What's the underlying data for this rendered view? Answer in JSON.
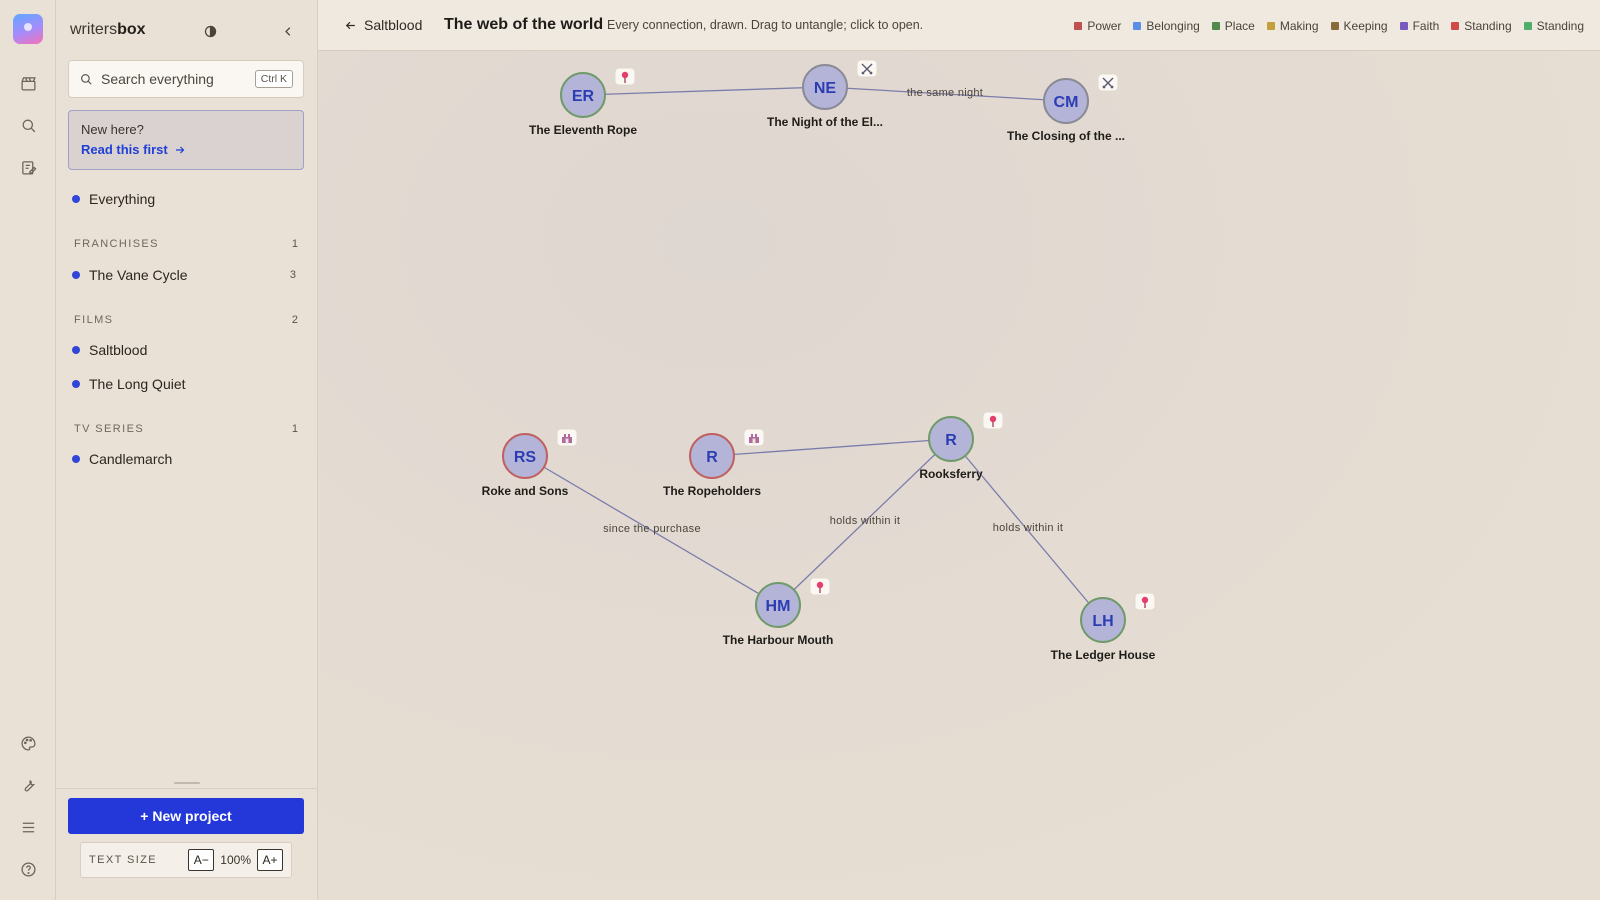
{
  "sidebar": {
    "brand_left": "writers",
    "brand_right": "box",
    "search_placeholder": "Search everything",
    "search_shortcut": "Ctrl K",
    "notice_title": "New here?",
    "notice_link": "Read this first",
    "everything": "Everything",
    "sections": [
      {
        "title": "FRANCHISES",
        "count": "1",
        "items": [
          {
            "label": "The Vane Cycle",
            "count": "3"
          }
        ]
      },
      {
        "title": "FILMS",
        "count": "2",
        "items": [
          {
            "label": "Saltblood",
            "count": ""
          },
          {
            "label": "The Long Quiet",
            "count": ""
          }
        ]
      },
      {
        "title": "TV SERIES",
        "count": "1",
        "items": [
          {
            "label": "Candlemarch",
            "count": ""
          }
        ]
      }
    ],
    "new_project": "+ New project",
    "text_size_label": "TEXT SIZE",
    "text_size_dec": "A−",
    "text_size_value": "100%",
    "text_size_inc": "A+"
  },
  "header": {
    "back_label": "Saltblood",
    "title": "The web of the world",
    "subtitle": "Every connection, drawn. Drag to untangle; click to open.",
    "legend": [
      {
        "label": "Power",
        "color": "#c0504d"
      },
      {
        "label": "Belonging",
        "color": "#5b8ee6"
      },
      {
        "label": "Place",
        "color": "#4f8a4f"
      },
      {
        "label": "Making",
        "color": "#c4a03a"
      },
      {
        "label": "Keeping",
        "color": "#8a6a3a"
      },
      {
        "label": "Faith",
        "color": "#7b5bbf"
      },
      {
        "label": "Standing",
        "color": "#d04a4a"
      },
      {
        "label": "Standing",
        "color": "#4fae6a"
      }
    ]
  },
  "graph": {
    "nodes": [
      {
        "id": "er",
        "initials": "ER",
        "label": "The Eleventh Rope",
        "ring": "#6f9a6a",
        "badge": "pin"
      },
      {
        "id": "ne",
        "initials": "NE",
        "label": "The Night of the El...",
        "ring": "#8a8a96",
        "badge": "swords"
      },
      {
        "id": "cm",
        "initials": "CM",
        "label": "The Closing of the ...",
        "ring": "#8a8a96",
        "badge": "swords"
      },
      {
        "id": "rs",
        "initials": "RS",
        "label": "Roke and Sons",
        "ring": "#c06060",
        "badge": "castle"
      },
      {
        "id": "rh",
        "initials": "R",
        "label": "The Ropeholders",
        "ring": "#c06060",
        "badge": "castle"
      },
      {
        "id": "rf",
        "initials": "R",
        "label": "Rooksferry",
        "ring": "#6f9a6a",
        "badge": "pin"
      },
      {
        "id": "hm",
        "initials": "HM",
        "label": "The Harbour Mouth",
        "ring": "#6f9a6a",
        "badge": "pin"
      },
      {
        "id": "lh",
        "initials": "LH",
        "label": "The Ledger House",
        "ring": "#6f9a6a",
        "badge": "pin"
      }
    ],
    "edges": [
      {
        "from": "er",
        "to": "ne",
        "label": ""
      },
      {
        "from": "ne",
        "to": "cm",
        "label": "the same night"
      },
      {
        "from": "rh",
        "to": "rf",
        "label": ""
      },
      {
        "from": "rs",
        "to": "hm",
        "label": "since the purchase"
      },
      {
        "from": "rf",
        "to": "hm",
        "label": "holds within it"
      },
      {
        "from": "rf",
        "to": "lh",
        "label": "holds within it"
      }
    ]
  }
}
